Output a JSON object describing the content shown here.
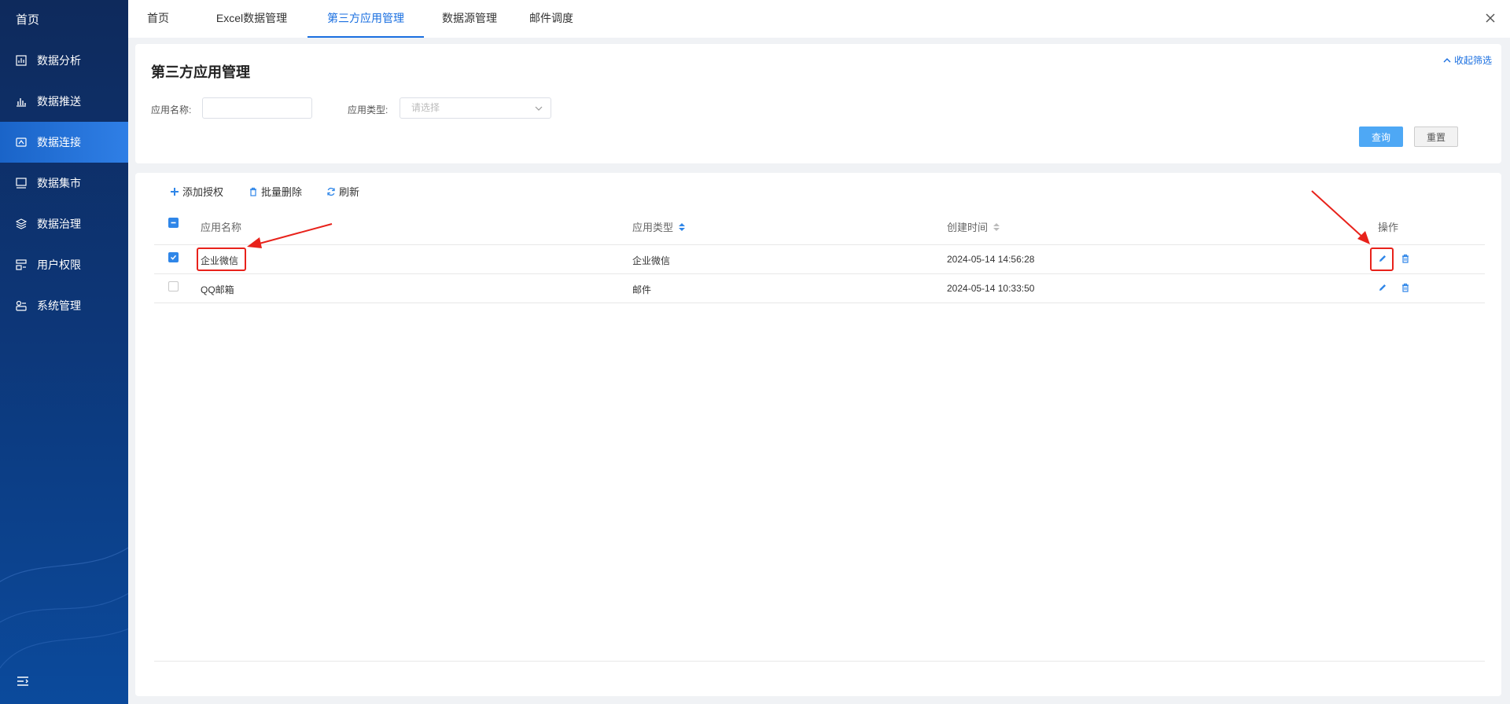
{
  "sidebar": {
    "home": "首页",
    "items": [
      {
        "label": "数据分析",
        "icon": "chart-icon"
      },
      {
        "label": "数据推送",
        "icon": "bar-chart-icon"
      },
      {
        "label": "数据连接",
        "icon": "connection-icon",
        "active": true
      },
      {
        "label": "数据集市",
        "icon": "monitor-icon"
      },
      {
        "label": "数据治理",
        "icon": "layers-icon"
      },
      {
        "label": "用户权限",
        "icon": "user-permission-icon"
      },
      {
        "label": "系统管理",
        "icon": "settings-icon"
      }
    ]
  },
  "tabs": [
    "首页",
    "Excel数据管理",
    "第三方应用管理",
    "数据源管理",
    "邮件调度"
  ],
  "active_tab": "第三方应用管理",
  "filter": {
    "title": "第三方应用管理",
    "collapse_label": "收起筛选",
    "app_name_label": "应用名称:",
    "app_name_value": "",
    "app_type_label": "应用类型:",
    "app_type_placeholder": "请选择",
    "query_label": "查询",
    "reset_label": "重置"
  },
  "toolbar": {
    "add_label": "添加授权",
    "batch_delete_label": "批量删除",
    "refresh_label": "刷新"
  },
  "table": {
    "columns": [
      "应用名称",
      "应用类型",
      "创建时间",
      "操作"
    ],
    "rows": [
      {
        "name": "企业微信",
        "type": "企业微信",
        "created": "2024-05-14 14:56:28",
        "checked": true
      },
      {
        "name": "QQ邮箱",
        "type": "邮件",
        "created": "2024-05-14 10:33:50",
        "checked": false
      }
    ]
  },
  "colors": {
    "accent": "#1a6fe0",
    "sidebar_active": "#2f7fe6",
    "annotation": "#e8221b",
    "query_button": "#4ea8f5"
  }
}
